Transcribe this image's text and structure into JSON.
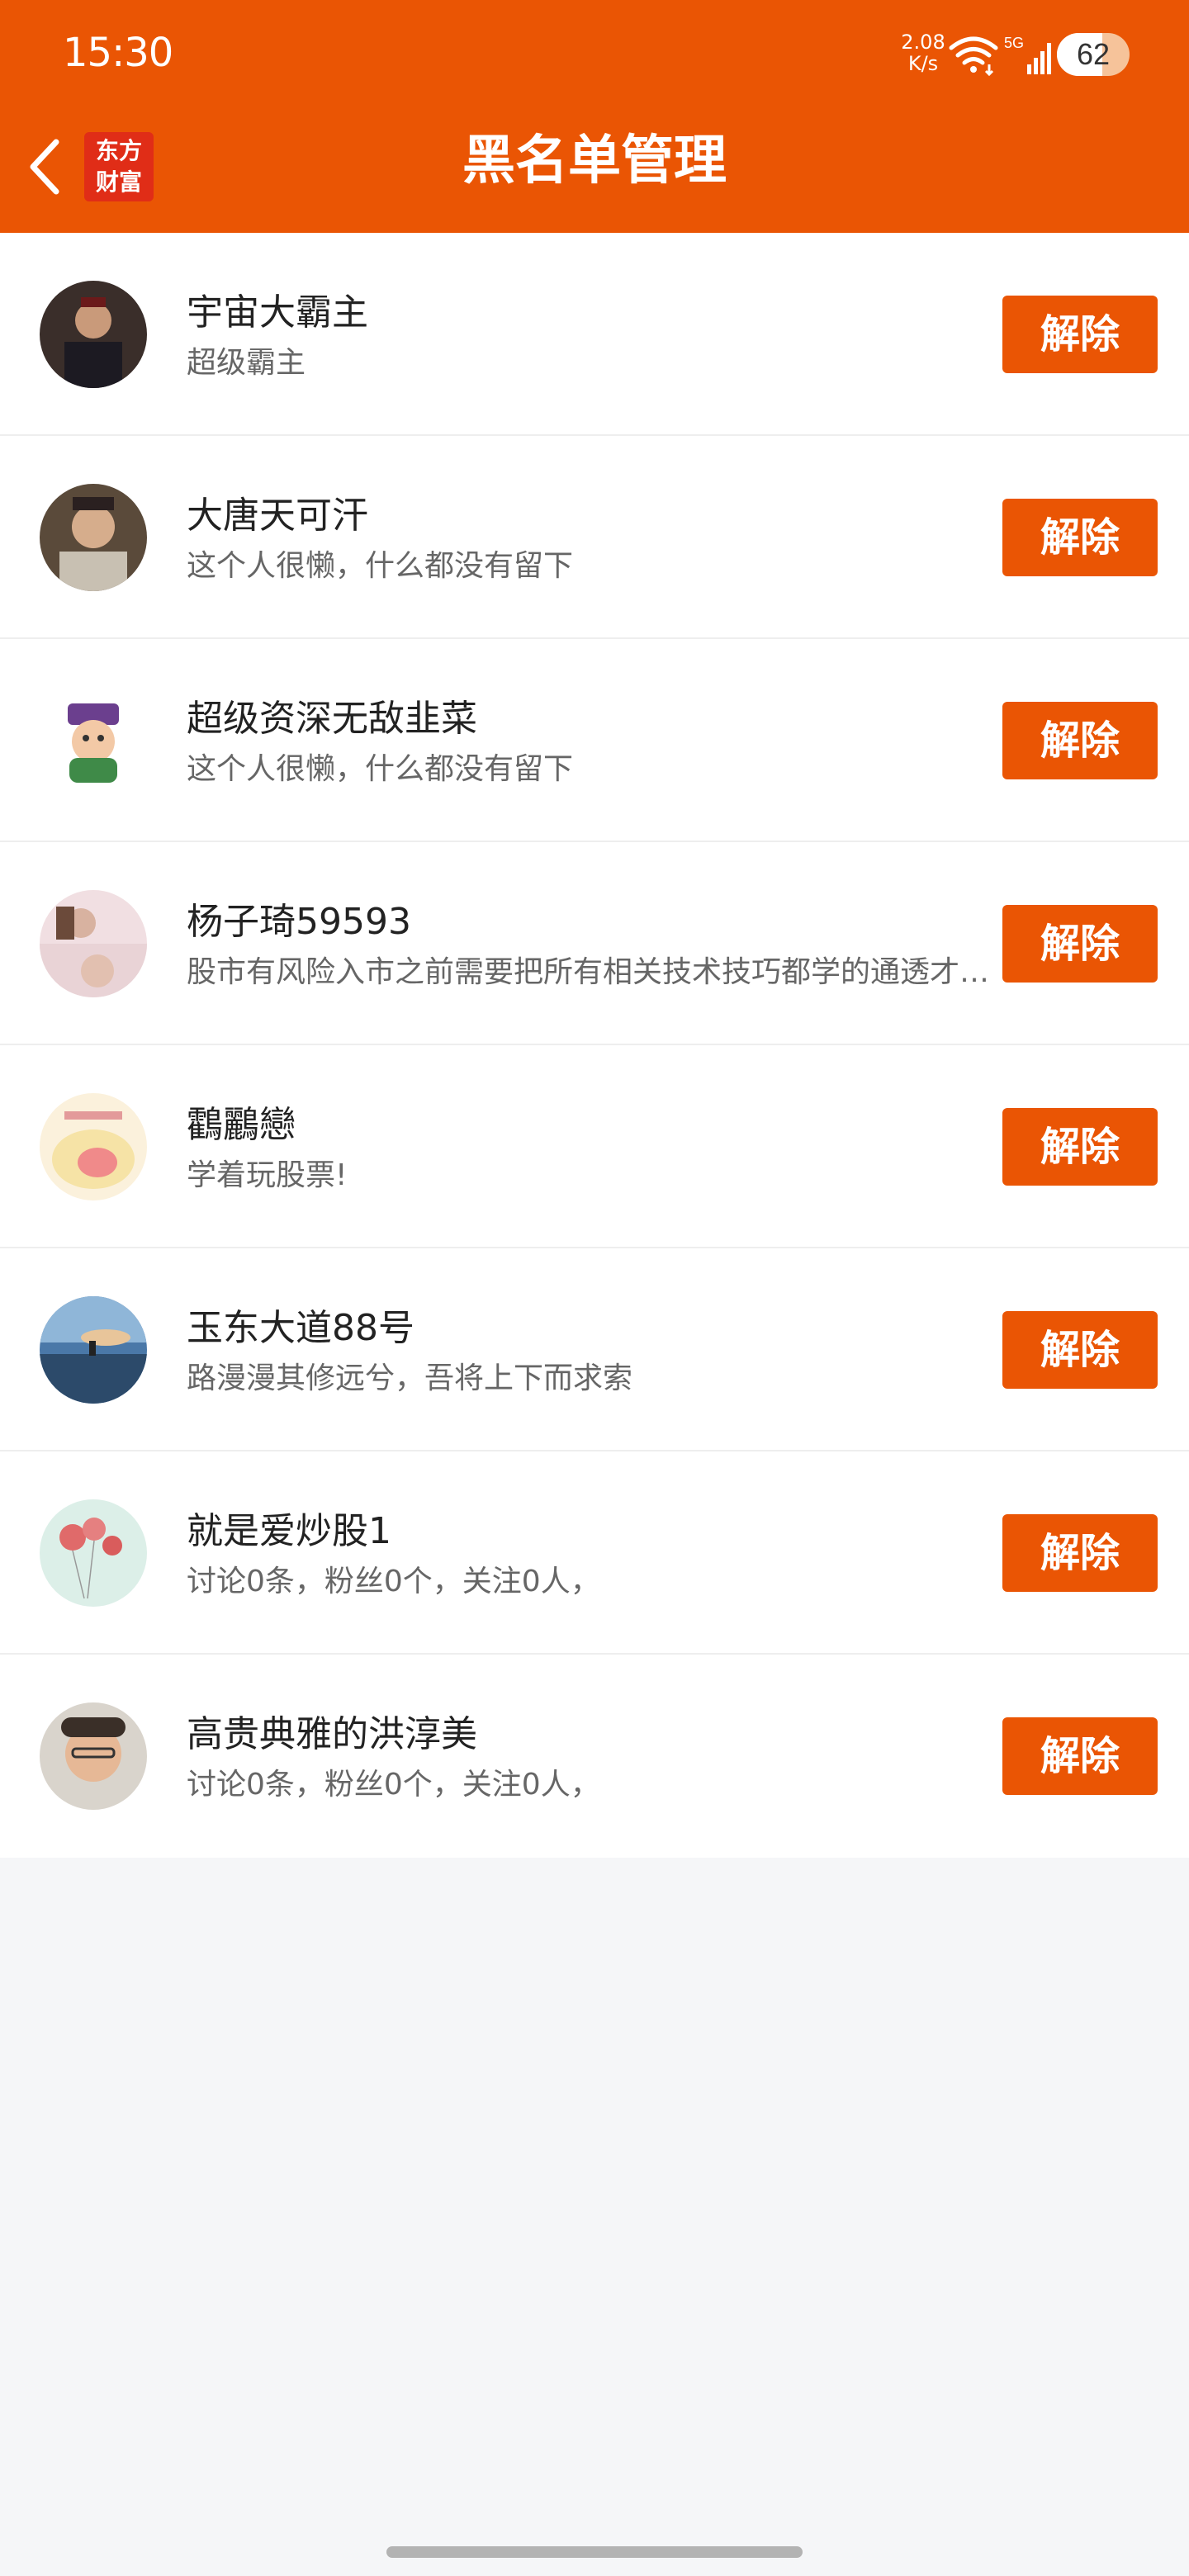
{
  "status_bar": {
    "time": "15:30",
    "net_speed_value": "2.08",
    "net_speed_unit": "K/s",
    "wifi_icon": "wifi-icon",
    "signal_icon": "signal-5g-icon",
    "signal_label": "5G",
    "battery_percent": "62",
    "battery_level": 0.62
  },
  "header": {
    "back_icon": "chevron-left-icon",
    "logo_line1": "东方",
    "logo_line2": "财富",
    "title": "黑名单管理",
    "background_color": "#ea5504"
  },
  "blocked_users": [
    {
      "name": "宇宙大霸主",
      "description": "超级霸主",
      "action_label": "解除"
    },
    {
      "name": "大唐天可汗",
      "description": "这个人很懒，什么都没有留下",
      "action_label": "解除"
    },
    {
      "name": "超级资深无敌韭菜",
      "description": "这个人很懒，什么都没有留下",
      "action_label": "解除"
    },
    {
      "name": "杨子琦59593",
      "description": "股市有风险入市之前需要把所有相关技术技巧都学的通透才能入市",
      "action_label": "解除"
    },
    {
      "name": "鸖鸝戀",
      "description": "学着玩股票!",
      "action_label": "解除"
    },
    {
      "name": "玉东大道88号",
      "description": "路漫漫其修远兮，吾将上下而求索",
      "action_label": "解除"
    },
    {
      "name": "就是爱炒股1",
      "description": "讨论0条，粉丝0个，关注0人，",
      "action_label": "解除"
    },
    {
      "name": "高贵典雅的洪淳美",
      "description": "讨论0条，粉丝0个，关注0人，",
      "action_label": "解除"
    }
  ],
  "colors": {
    "accent": "#ea5504",
    "background": "#f5f6f8",
    "text_primary": "#222222",
    "text_secondary": "#666666"
  }
}
